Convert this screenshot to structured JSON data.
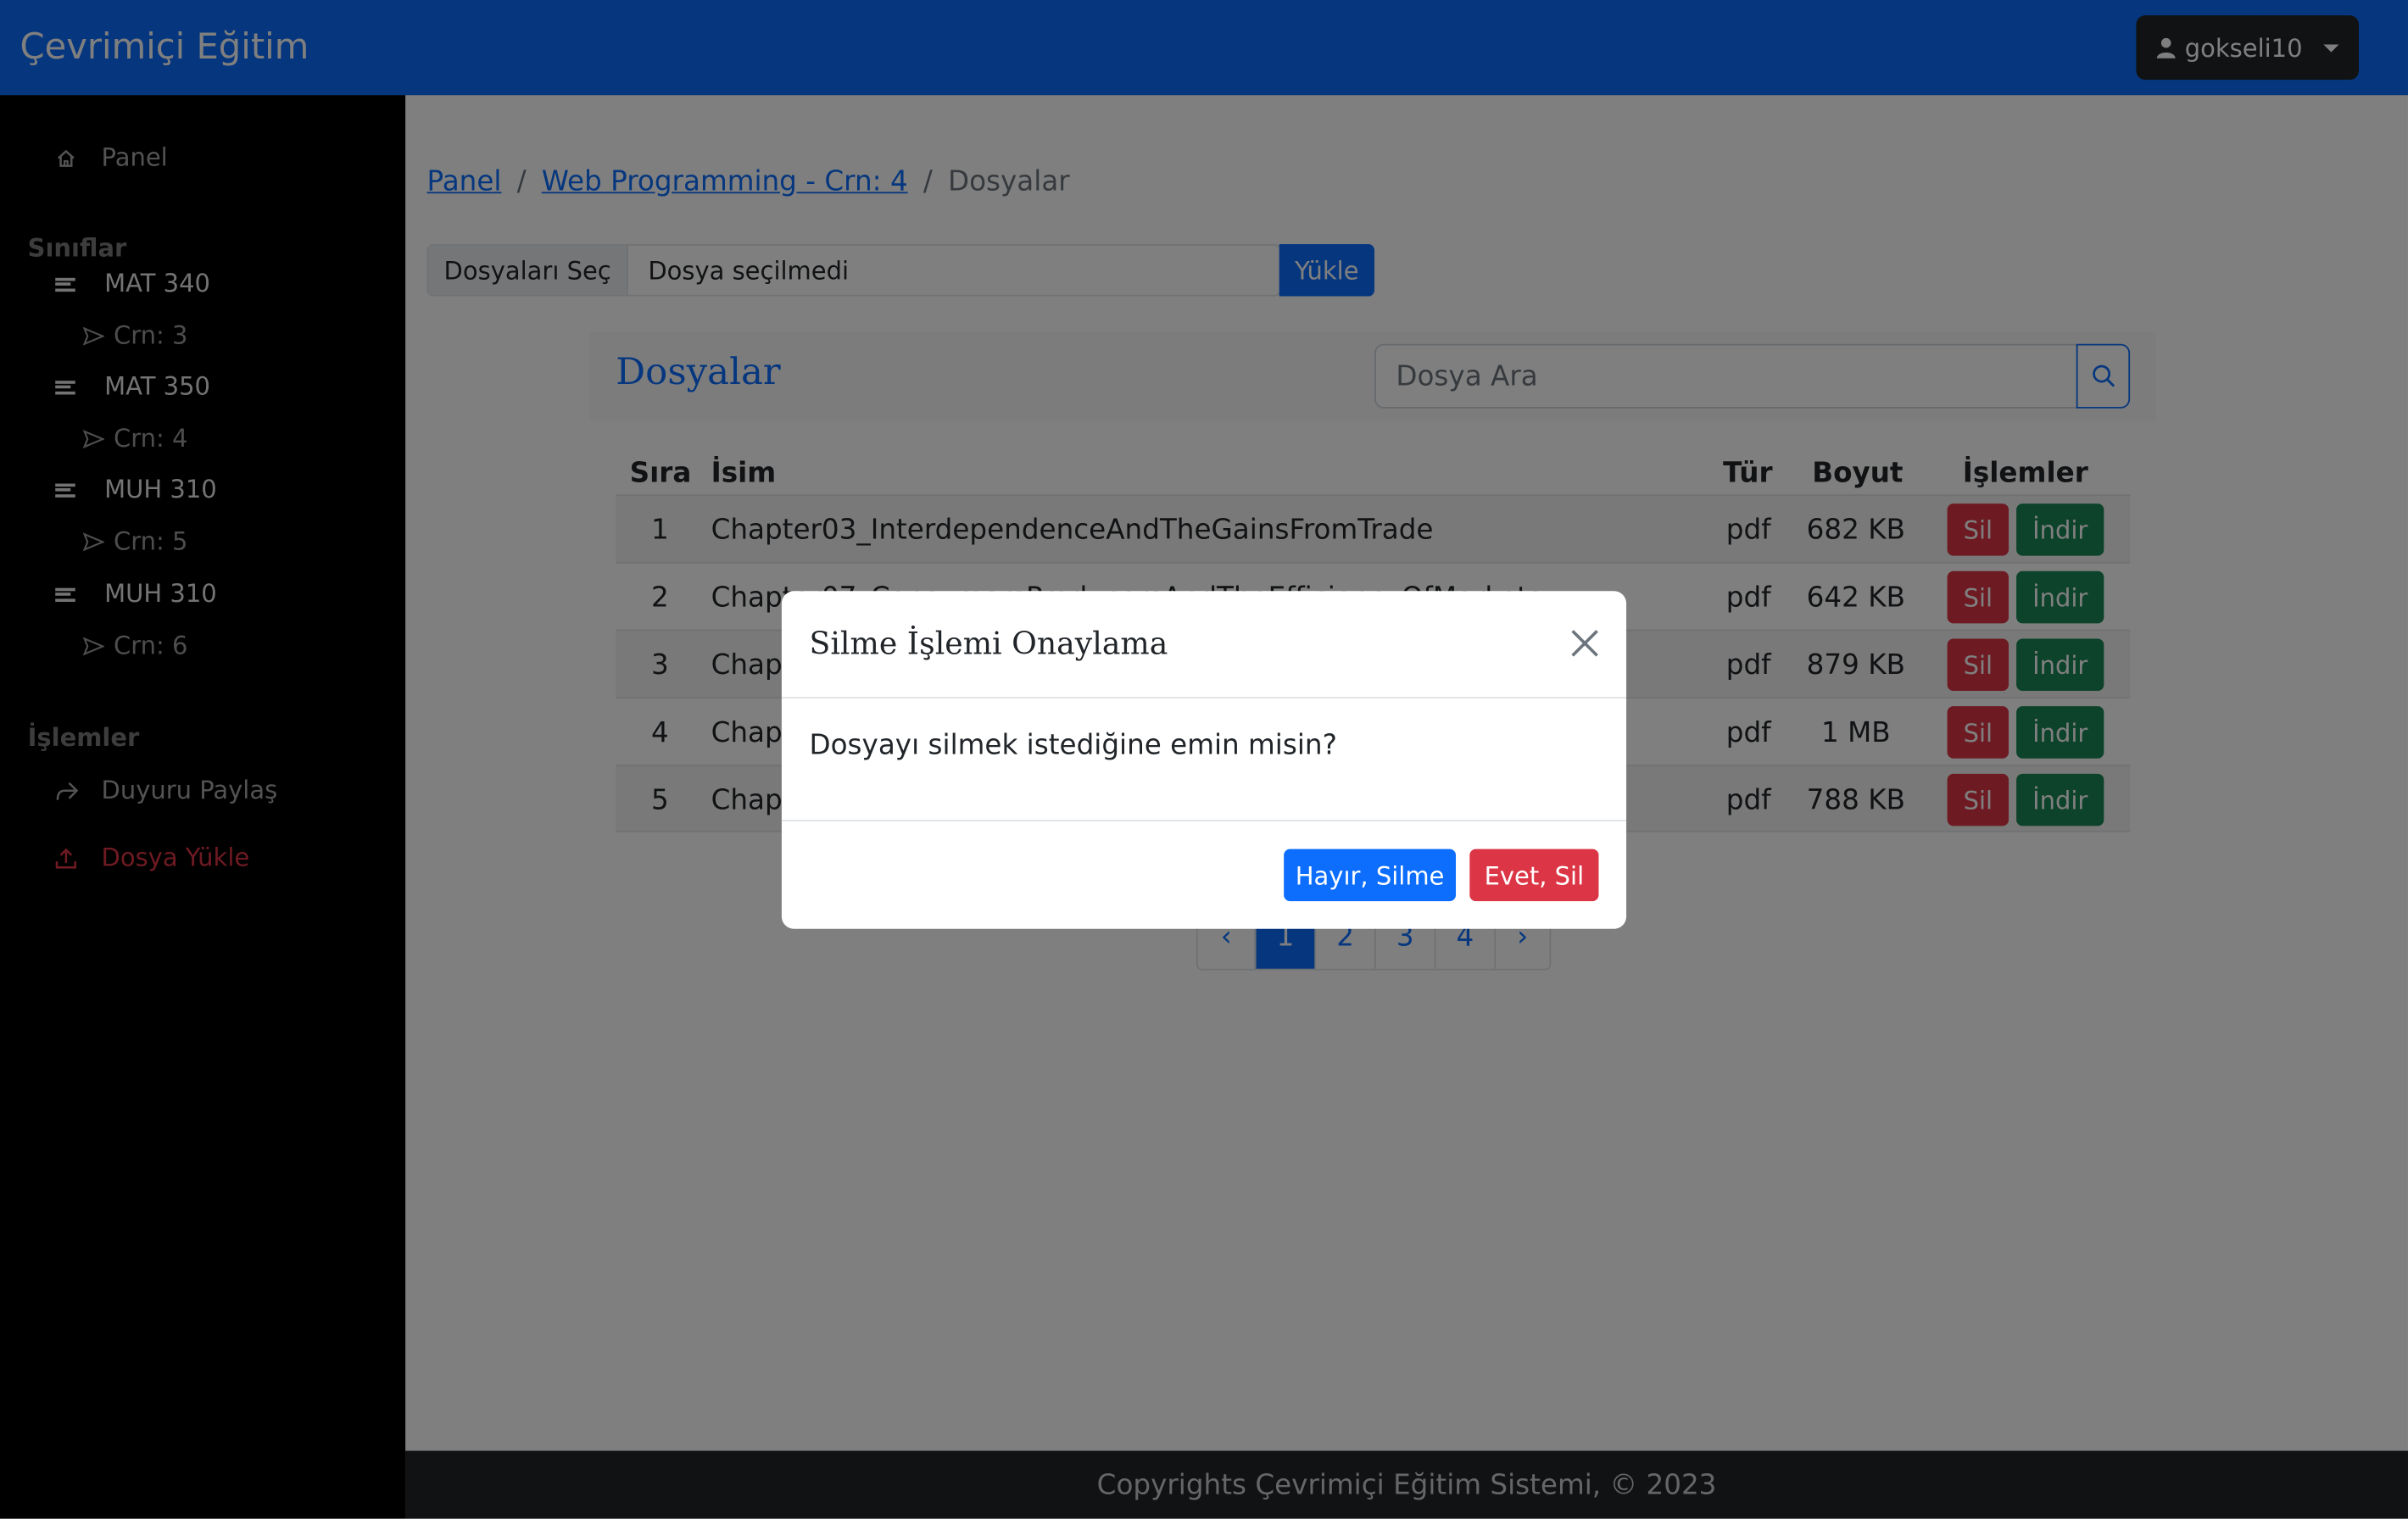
{
  "app": {
    "brand": "Çevrimiçi Eğitim"
  },
  "user": {
    "name": "gokseli10"
  },
  "sidebar": {
    "panel": "Panel",
    "classes_heading": "Sınıflar",
    "classes": [
      {
        "name": "MAT 340",
        "crn": "Crn: 3"
      },
      {
        "name": "MAT 350",
        "crn": "Crn: 4"
      },
      {
        "name": "MUH 310",
        "crn": "Crn: 5"
      },
      {
        "name": "MUH 310",
        "crn": "Crn: 6"
      }
    ],
    "actions_heading": "İşlemler",
    "share_announcement": "Duyuru Paylaş",
    "upload_file": "Dosya Yükle"
  },
  "breadcrumb": {
    "home": "Panel",
    "course": "Web Programming - Crn: 4",
    "current": "Dosyalar",
    "separator": "/"
  },
  "upload": {
    "choose_label": "Dosyaları Seç",
    "no_file": "Dosya seçilmedi",
    "button": "Yükle"
  },
  "files": {
    "title": "Dosyalar",
    "search_placeholder": "Dosya Ara",
    "headers": {
      "index": "Sıra",
      "name": "İsim",
      "type": "Tür",
      "size": "Boyut",
      "actions": "İşlemler"
    },
    "rows": [
      {
        "index": "1",
        "name": "Chapter03_InterdependenceAndTheGainsFromTrade",
        "type": "pdf",
        "size": "682 KB"
      },
      {
        "index": "2",
        "name": "Chapter07_ConsumersProducersAndTheEfficiencyOfMarkets",
        "type": "pdf",
        "size": "642 KB"
      },
      {
        "index": "3",
        "name": "Chap",
        "type": "pdf",
        "size": "879 KB"
      },
      {
        "index": "4",
        "name": "Chap",
        "type": "pdf",
        "size": "1 MB"
      },
      {
        "index": "5",
        "name": "Chap",
        "type": "pdf",
        "size": "788 KB"
      }
    ],
    "delete_label": "Sil",
    "download_label": "İndir"
  },
  "pagination": {
    "prev": "‹",
    "pages": [
      "1",
      "2",
      "3",
      "4"
    ],
    "next": "›",
    "active": "1"
  },
  "footer": {
    "text": "Copyrights Çevrimiçi Eğitim Sistemi, © 2023"
  },
  "modal": {
    "title": "Silme İşlemi Onaylama",
    "body": "Dosyayı silmek istediğine emin misin?",
    "cancel": "Hayır, Silme",
    "confirm": "Evet, Sil"
  },
  "icons": {
    "home": "home-icon",
    "list": "list-icon",
    "send": "send-icon",
    "share": "share-icon",
    "upload": "upload-icon",
    "user": "user-icon",
    "search": "search-icon",
    "close": "close-icon"
  },
  "colors": {
    "primary": "#0d6efd",
    "danger": "#dc3545",
    "success": "#198754",
    "dark": "#212529"
  }
}
